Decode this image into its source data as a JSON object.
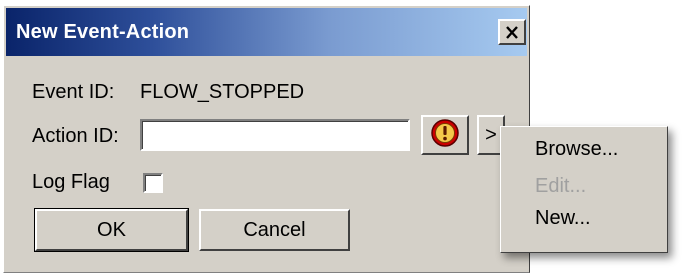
{
  "window": {
    "title": "New Event-Action",
    "close_label": "X"
  },
  "form": {
    "event_id_label": "Event ID:",
    "event_id_value": "FLOW_STOPPED",
    "action_id_label": "Action ID:",
    "action_id_value": "",
    "log_flag_label": "Log Flag",
    "log_flag_checked": false,
    "more_button_label": ">"
  },
  "buttons": {
    "ok_label": "OK",
    "cancel_label": "Cancel"
  },
  "menu": {
    "items": [
      {
        "label": "Browse...",
        "enabled": true
      },
      {
        "label": "Edit...",
        "enabled": false
      },
      {
        "label": "New...",
        "enabled": true
      }
    ]
  },
  "colors": {
    "dialog_face": "#d4d0c8",
    "title_start": "#0a246a",
    "title_end": "#a6caf0",
    "disabled_text": "#a0a0a0",
    "alert_icon": "#cc0000"
  },
  "icons": {
    "alert": "alert-icon",
    "close": "close-icon"
  }
}
